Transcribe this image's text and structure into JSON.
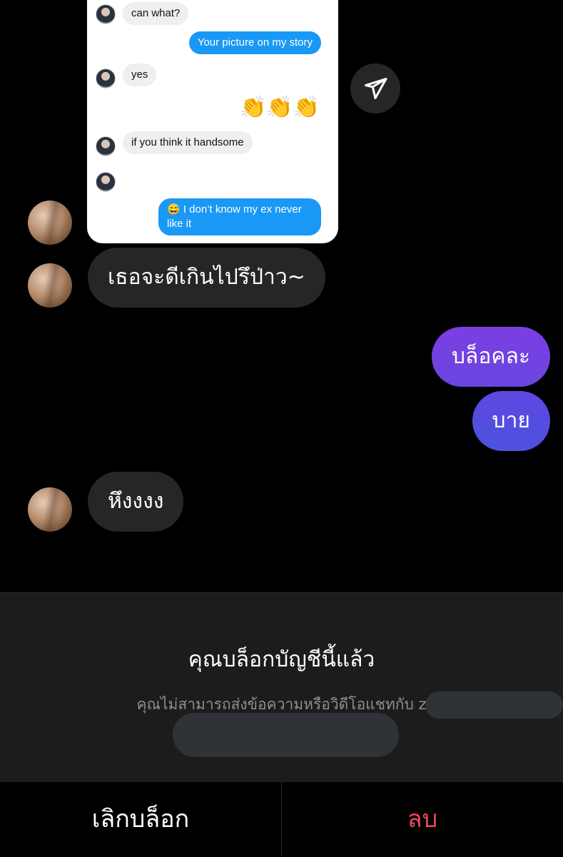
{
  "shared_screenshot": {
    "messages": [
      {
        "from": "them",
        "text": "can what?"
      },
      {
        "from": "me",
        "text": "Your picture on my story"
      },
      {
        "from": "them",
        "text": "yes"
      },
      {
        "from": "me",
        "text": "👏👏👏"
      },
      {
        "from": "them",
        "text": "if you think it handsome"
      },
      {
        "from": "them",
        "text": "😆"
      },
      {
        "from": "me",
        "text": "😅 I don’t know my ex never like it"
      }
    ]
  },
  "chat": {
    "messages": [
      {
        "from": "them",
        "text": "เธอจะดีเกินไปรึป่าว~"
      },
      {
        "from": "me",
        "text": "บล็อคละ"
      },
      {
        "from": "me",
        "text": "บาย"
      },
      {
        "from": "them",
        "text": "หึงงงง"
      }
    ]
  },
  "blocked_sheet": {
    "title": "คุณบล็อกบัญชีนี้แล้ว",
    "subtitle": "คุณไม่สามารถส่งข้อความหรือวิดีโอแชทกับ z"
  },
  "actions": {
    "unblock": "เลิกบล็อก",
    "delete": "ลบ"
  },
  "colors": {
    "background": "#000000",
    "incoming_bubble": "#262626",
    "outgoing_gradient_top": "#7b3fe0",
    "outgoing_gradient_bottom": "#4f4fe0",
    "delete_red": "#ed4956",
    "screenshot_blue": "#1a98f5"
  },
  "icons": {
    "send": "paper-plane-icon"
  }
}
